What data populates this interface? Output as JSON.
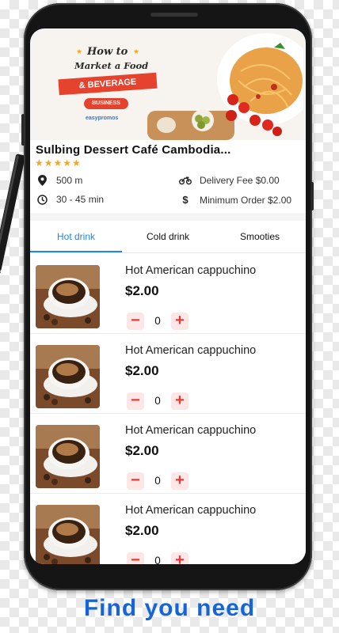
{
  "banner": {
    "line1": "How to",
    "line2": "Market a Food",
    "ribbon": "& BEVERAGE",
    "badge": "BUSINESS",
    "brand": "easypromos"
  },
  "restaurant": {
    "name": "Sulbing  Dessert Café Cambodia...",
    "rating_stars": "★★★★★",
    "rating": 5,
    "distance": "500 m",
    "delivery_fee": "Delivery Fee $0.00",
    "time": "30 - 45 min",
    "min_order": "Minimum Order $2.00"
  },
  "tabs": [
    {
      "label": "Hot drink",
      "active": true
    },
    {
      "label": "Cold drink",
      "active": false
    },
    {
      "label": "Smooties",
      "active": false
    }
  ],
  "items": [
    {
      "name": "Hot American cappuchino",
      "price": "$2.00",
      "qty": "0",
      "minus": "−",
      "plus": "+"
    },
    {
      "name": "Hot American cappuchino",
      "price": "$2.00",
      "qty": "0",
      "minus": "−",
      "plus": "+"
    },
    {
      "name": "Hot American cappuchino",
      "price": "$2.00",
      "qty": "0",
      "minus": "−",
      "plus": "+"
    },
    {
      "name": "Hot American cappuchino",
      "price": "$2.00",
      "qty": "0",
      "minus": "−",
      "plus": "+"
    }
  ],
  "caption": "Find you need",
  "colors": {
    "accent": "#1e88e5",
    "qty": "#e53935",
    "qty_bg": "#fde6e6",
    "star": "#f5a623",
    "caption": "#1565d8"
  },
  "icons": {
    "distance": "location-pin-icon",
    "delivery": "motorbike-icon",
    "time": "clock-icon",
    "min_order": "dollar-icon"
  }
}
